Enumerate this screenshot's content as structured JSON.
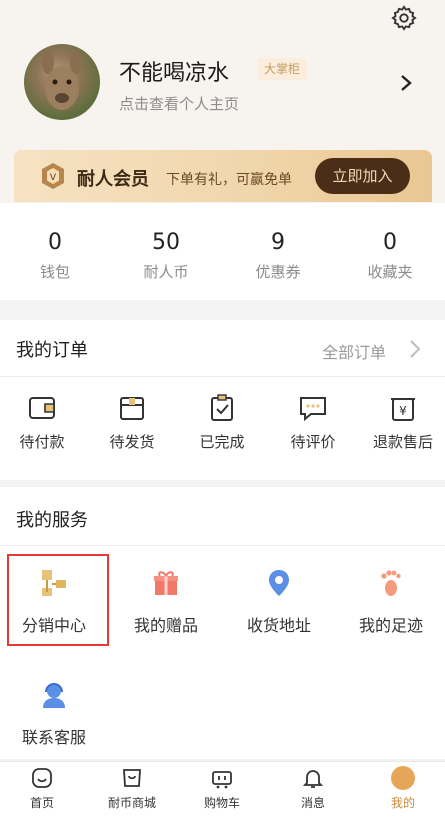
{
  "profile": {
    "username": "不能喝凉水",
    "badge": "大掌柜",
    "subtitle": "点击查看个人主页"
  },
  "member": {
    "title": "耐人会员",
    "desc": "下单有礼，可赢免单",
    "join_label": "立即加入"
  },
  "stats": [
    {
      "value": "0",
      "label": "钱包"
    },
    {
      "value": "50",
      "label": "耐人币"
    },
    {
      "value": "9",
      "label": "优惠券"
    },
    {
      "value": "0",
      "label": "收藏夹"
    }
  ],
  "orders": {
    "title": "我的订单",
    "all_label": "全部订单",
    "items": [
      {
        "label": "待付款",
        "icon": "wallet-icon"
      },
      {
        "label": "待发货",
        "icon": "box-icon"
      },
      {
        "label": "已完成",
        "icon": "clipboard-check-icon"
      },
      {
        "label": "待评价",
        "icon": "comment-icon"
      },
      {
        "label": "退款售后",
        "icon": "refund-icon"
      }
    ]
  },
  "services": {
    "title": "我的服务",
    "items": [
      {
        "label": "分销中心",
        "icon": "distribution-icon"
      },
      {
        "label": "我的赠品",
        "icon": "gift-icon"
      },
      {
        "label": "收货地址",
        "icon": "location-icon"
      },
      {
        "label": "我的足迹",
        "icon": "footprint-icon"
      },
      {
        "label": "联系客服",
        "icon": "customer-service-icon"
      }
    ]
  },
  "tabs": [
    {
      "label": "首页",
      "icon": "home-icon"
    },
    {
      "label": "耐币商城",
      "icon": "shop-icon"
    },
    {
      "label": "购物车",
      "icon": "cart-icon"
    },
    {
      "label": "消息",
      "icon": "bell-icon"
    },
    {
      "label": "我的",
      "icon": "me-icon"
    }
  ],
  "colors": {
    "accent": "#c98a3b",
    "join_button": "#4b2d18",
    "highlight_border": "#e53935"
  }
}
